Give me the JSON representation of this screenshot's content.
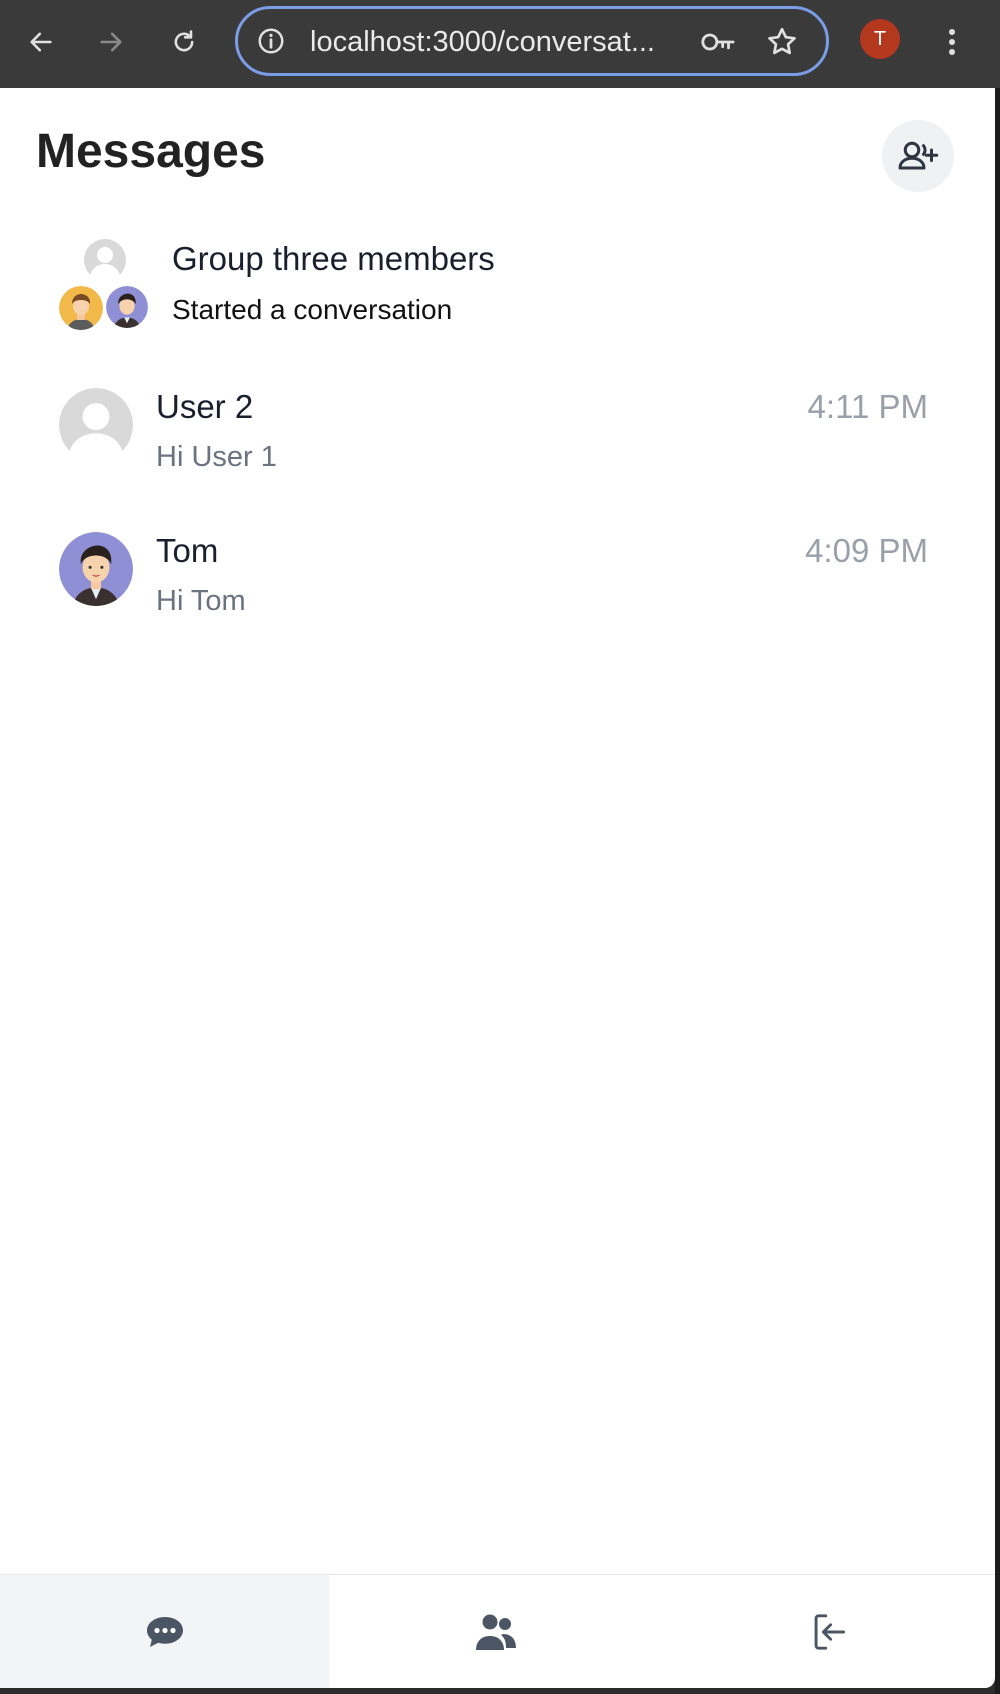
{
  "browser": {
    "url": "localhost:3000/conversat...",
    "profile_initial": "T"
  },
  "page": {
    "title": "Messages"
  },
  "conversations": [
    {
      "name": "Group three members",
      "preview": "Started a conversation",
      "time": ""
    },
    {
      "name": "User 2",
      "preview": "Hi User 1",
      "time": "4:11 PM"
    },
    {
      "name": "Tom",
      "preview": "Hi Tom",
      "time": "4:09 PM"
    }
  ],
  "colors": {
    "accent": "#7b9ce6",
    "profile": "#b4381e",
    "tom_avatar_bg": "#8f8fd6",
    "active_tab_bg": "#f3f4f6"
  },
  "icons": {
    "back": "arrow-left-icon",
    "forward": "arrow-right-icon",
    "reload": "reload-icon",
    "info": "info-icon",
    "key": "key-icon",
    "star": "star-icon",
    "menu": "more-vertical-icon",
    "add_contact": "user-plus-icon",
    "chats_tab": "chat-bubble-icon",
    "contacts_tab": "users-icon",
    "logout_tab": "logout-icon"
  }
}
